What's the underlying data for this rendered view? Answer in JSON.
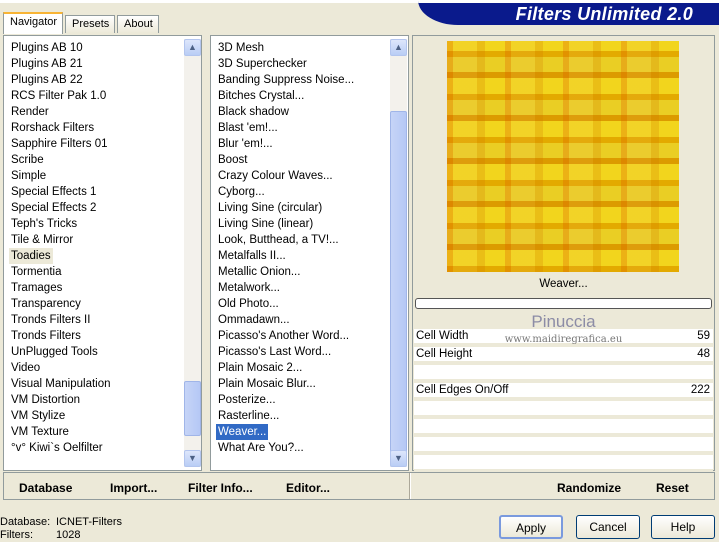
{
  "app": {
    "title": "Filters Unlimited 2.0"
  },
  "tabs": [
    {
      "label": "Navigator",
      "active": true
    },
    {
      "label": "Presets"
    },
    {
      "label": "About"
    }
  ],
  "categories": {
    "items": [
      "Plugins AB 10",
      "Plugins AB 21",
      "Plugins AB 22",
      "RCS Filter Pak 1.0",
      "Render",
      "Rorshack Filters",
      "Sapphire Filters 01",
      "Scribe",
      "Simple",
      "Special Effects 1",
      "Special Effects 2",
      "Teph's Tricks",
      "Tile & Mirror",
      "Toadies",
      "Tormentia",
      "Tramages",
      "Transparency",
      "Tronds Filters II",
      "Tronds Filters",
      "UnPlugged Tools",
      "Video",
      "Visual Manipulation",
      "VM Distortion",
      "VM Stylize",
      "VM Texture",
      "°v° Kiwi`s Oelfilter"
    ],
    "selected": "Toadies"
  },
  "filters": {
    "items": [
      "3D Mesh",
      "3D Superchecker",
      "Banding Suppress Noise...",
      "Bitches Crystal...",
      "Black shadow",
      "Blast 'em!...",
      "Blur 'em!...",
      "Boost",
      "Crazy Colour Waves...",
      "Cyborg...",
      "Living Sine (circular)",
      "Living Sine (linear)",
      "Look, Butthead, a TV!...",
      "Metalfalls II...",
      "Metallic Onion...",
      "Metalwork...",
      "Old Photo...",
      "Ommadawn...",
      "Picasso's Another Word...",
      "Picasso's Last Word...",
      "Plain Mosaic 2...",
      "Plain Mosaic Blur...",
      "Posterize...",
      "Rasterline...",
      "Weaver...",
      "What Are You?..."
    ],
    "selected": "Weaver..."
  },
  "preview": {
    "filter_name": "Weaver...",
    "watermark_name": "Pinuccia",
    "watermark_url": "www.maidiregrafica.eu"
  },
  "params": [
    {
      "label": "Cell Width",
      "value": "59"
    },
    {
      "label": "Cell Height",
      "value": "48"
    },
    {
      "label": "",
      "value": ""
    },
    {
      "label": "Cell Edges On/Off",
      "value": "222"
    },
    {
      "label": "",
      "value": ""
    },
    {
      "label": "",
      "value": ""
    },
    {
      "label": "",
      "value": ""
    },
    {
      "label": "",
      "value": ""
    }
  ],
  "buttonbar": {
    "database": "Database",
    "import": "Import...",
    "filter_info": "Filter Info...",
    "editor": "Editor...",
    "randomize": "Randomize",
    "reset": "Reset"
  },
  "status": {
    "database_label": "Database:",
    "database_value": "ICNET-Filters",
    "filters_label": "Filters:",
    "filters_value": "1028"
  },
  "dialog": {
    "apply": "Apply",
    "cancel": "Cancel",
    "help": "Help"
  }
}
